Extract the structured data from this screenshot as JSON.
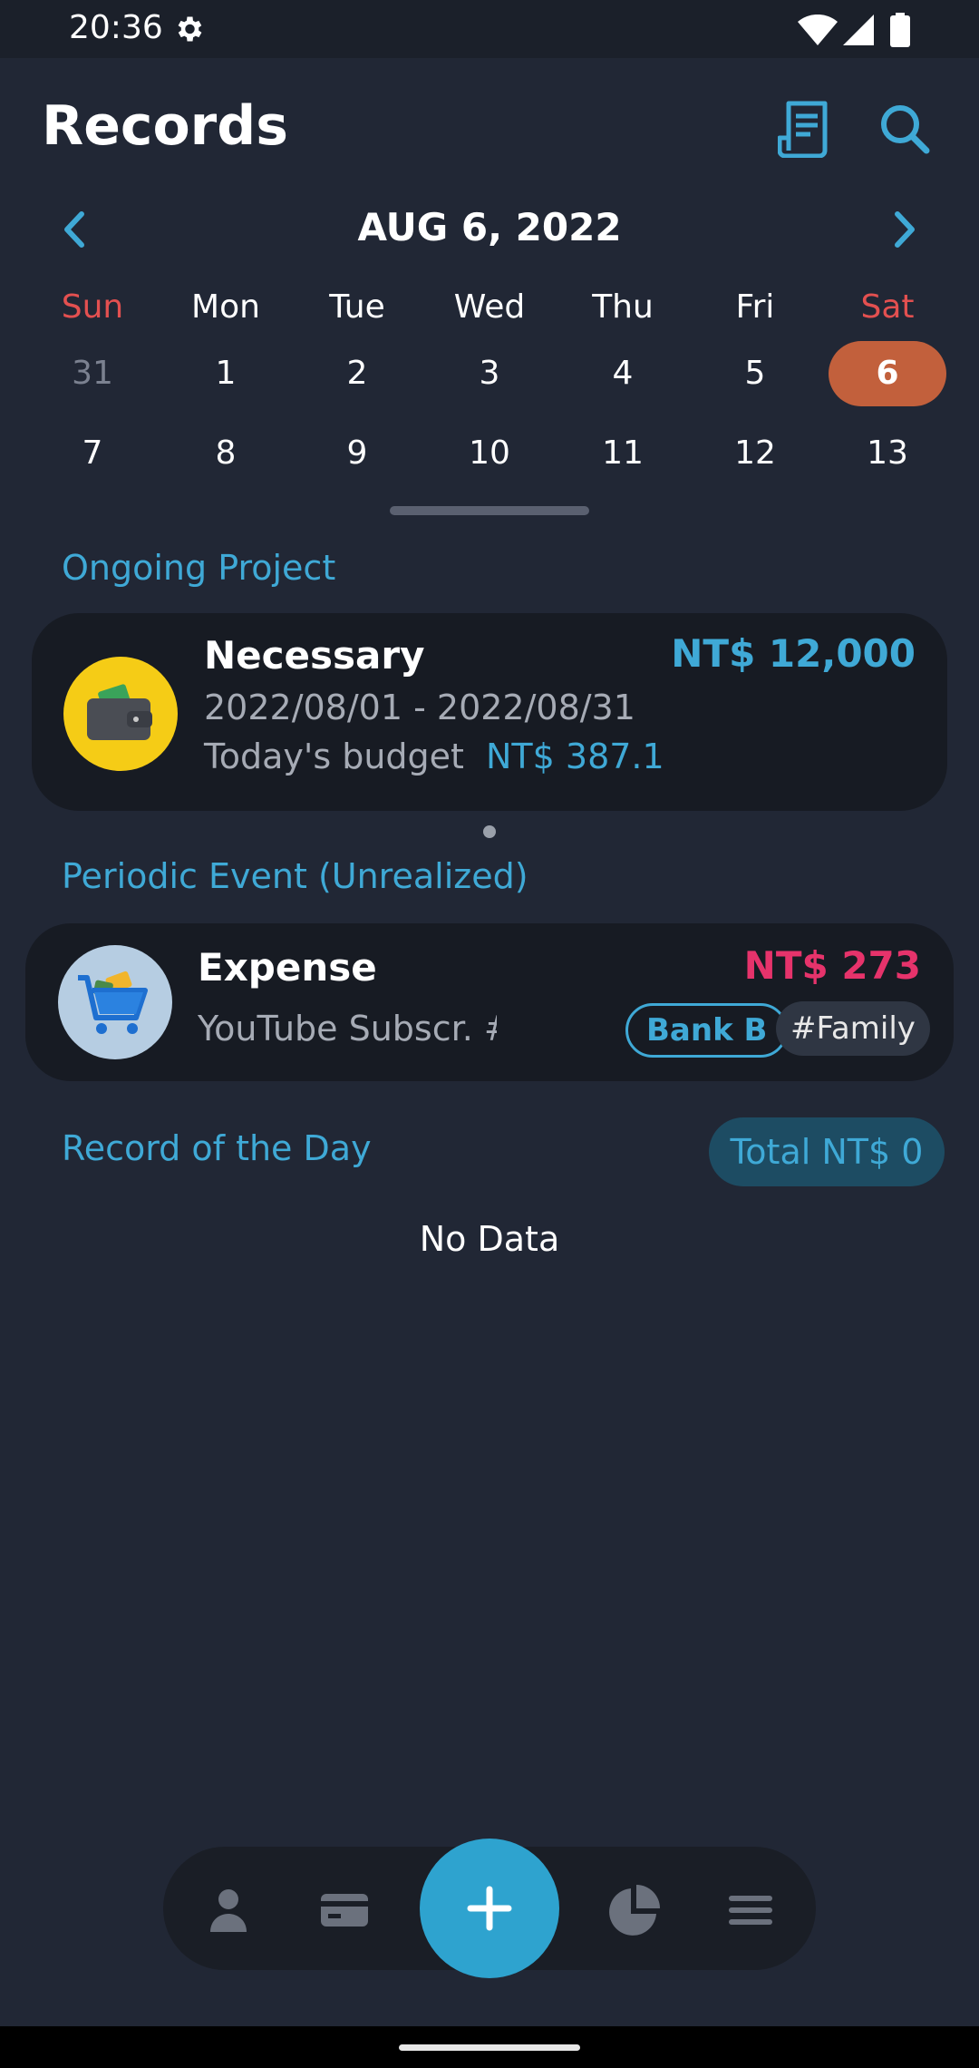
{
  "status": {
    "time": "20:36"
  },
  "header": {
    "title": "Records"
  },
  "calendar": {
    "title": "AUG 6, 2022",
    "weekdays": [
      "Sun",
      "Mon",
      "Tue",
      "Wed",
      "Thu",
      "Fri",
      "Sat"
    ],
    "week1": [
      "31",
      "1",
      "2",
      "3",
      "4",
      "5",
      "6"
    ],
    "week2": [
      "7",
      "8",
      "9",
      "10",
      "11",
      "12",
      "13"
    ],
    "selected_day": "6"
  },
  "ongoing": {
    "section_title": "Ongoing Project",
    "name": "Necessary",
    "amount": "NT$ 12,000",
    "range": "2022/08/01 - 2022/08/31",
    "budget_label": "Today's budget",
    "budget_value": "NT$ 387.1"
  },
  "periodic": {
    "section_title": "Periodic Event (Unrealized)",
    "type": "Expense",
    "amount": "NT$ 273",
    "description": "YouTube Subscr. #",
    "account_tag": "Bank B",
    "hashtag": "#Family"
  },
  "day_records": {
    "section_title": "Record of the Day",
    "total": "Total NT$ 0",
    "empty_text": "No Data"
  },
  "colors": {
    "background": "#212735",
    "accent": "#3fa9d6",
    "expense": "#e6336b",
    "selected_day": "#c2603c",
    "weekend": "#e35050"
  },
  "icons": [
    "settings-icon",
    "wifi-icon",
    "signal-icon",
    "battery-icon",
    "receipt-icon",
    "search-icon",
    "chevron-left-icon",
    "chevron-right-icon",
    "wallet-icon",
    "shopping-cart-icon",
    "person-icon",
    "card-icon",
    "plus-icon",
    "pie-chart-icon",
    "menu-icon"
  ]
}
